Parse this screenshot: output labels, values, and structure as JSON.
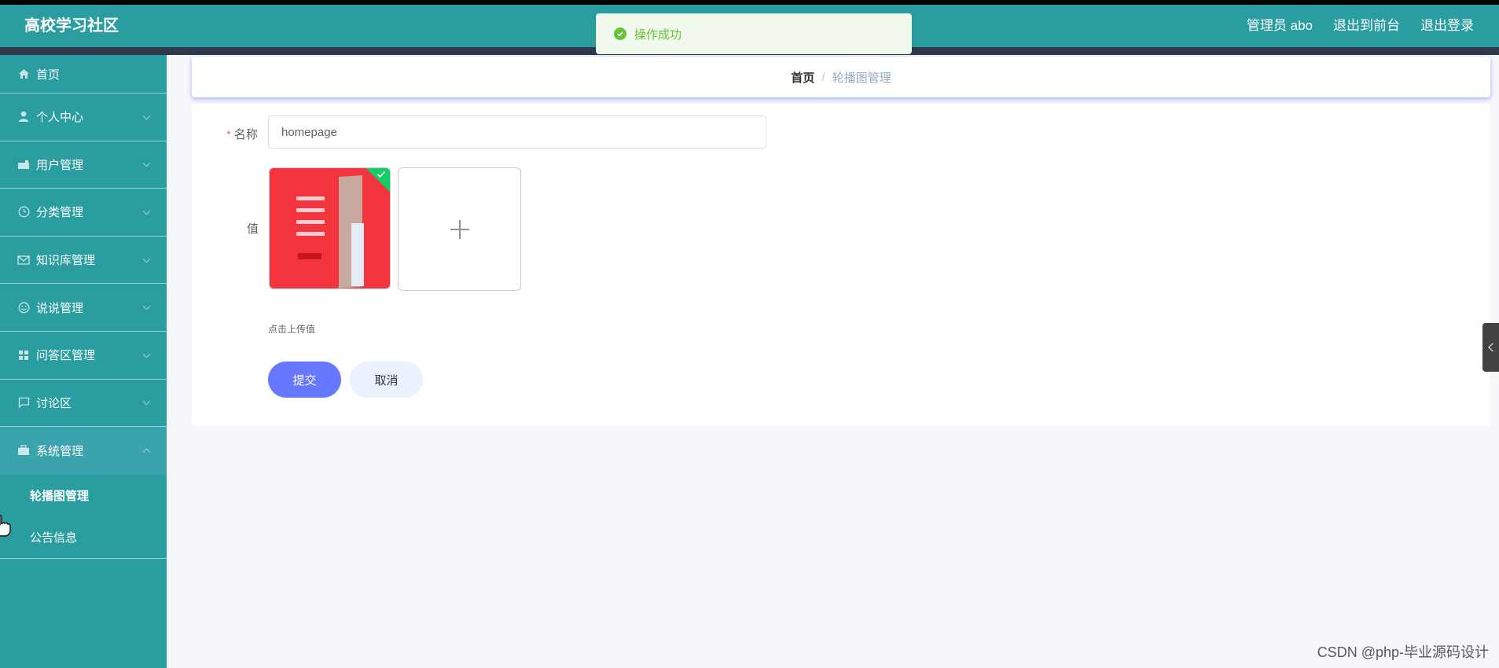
{
  "header": {
    "brand": "高校学习社区",
    "admin": "管理员 abo",
    "to_front": "退出到前台",
    "logout": "退出登录",
    "accent_color": "#2a9da0"
  },
  "toast": {
    "message": "操作成功",
    "icon": "check-circle-icon"
  },
  "sidebar": {
    "items": [
      {
        "label": "首页",
        "icon": "home-icon"
      },
      {
        "label": "个人中心",
        "icon": "user-icon"
      },
      {
        "label": "用户管理",
        "icon": "briefcase-icon"
      },
      {
        "label": "分类管理",
        "icon": "clock-icon"
      },
      {
        "label": "知识库管理",
        "icon": "mail-icon"
      },
      {
        "label": "说说管理",
        "icon": "smile-icon"
      },
      {
        "label": "问答区管理",
        "icon": "grid-icon"
      },
      {
        "label": "讨论区",
        "icon": "message-icon"
      },
      {
        "label": "系统管理",
        "icon": "toolbox-icon"
      }
    ],
    "submenu": [
      {
        "label": "轮播图管理"
      },
      {
        "label": "公告信息"
      }
    ]
  },
  "breadcrumb": {
    "home": "首页",
    "separator": "/",
    "current": "轮播图管理"
  },
  "form": {
    "name_label": "名称",
    "required_mark": "*",
    "name_value": "homepage",
    "value_label": "值",
    "upload_tip": "点击上传值",
    "submit": "提交",
    "cancel": "取消"
  },
  "watermark": "CSDN @php-毕业源码设计"
}
